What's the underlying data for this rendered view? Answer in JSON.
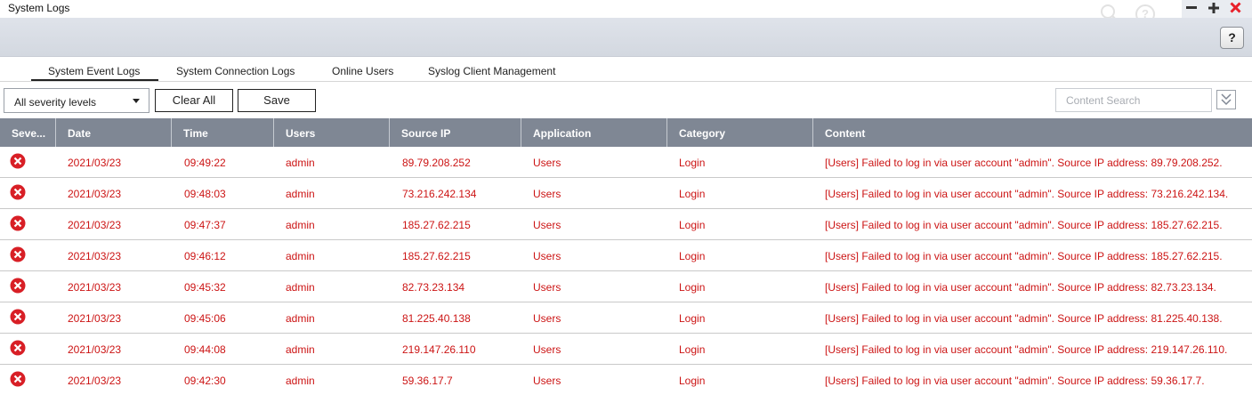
{
  "window": {
    "title": "System Logs",
    "icons": [
      "search-icon",
      "help-circle-icon",
      "minimize-icon",
      "maximize-icon",
      "close-icon"
    ],
    "close_color": "#e8202a"
  },
  "toolbar": {
    "help_label": "?"
  },
  "tabs": [
    {
      "label": "System Event Logs",
      "active": true
    },
    {
      "label": "System Connection Logs",
      "active": false
    },
    {
      "label": "Online Users",
      "active": false
    },
    {
      "label": "Syslog Client Management",
      "active": false
    }
  ],
  "filter": {
    "severity_value": "All severity levels",
    "clear_all_label": "Clear All",
    "save_label": "Save",
    "search_placeholder": "Content Search",
    "search_value": ""
  },
  "table": {
    "columns": [
      "Seve...",
      "Date",
      "Time",
      "Users",
      "Source IP",
      "Application",
      "Category",
      "Content"
    ],
    "header_color": "#7f8794",
    "error_color": "#cc1414",
    "rows": [
      {
        "severity": "error-icon",
        "date": "2021/03/23",
        "time": "09:49:22",
        "user": "admin",
        "ip": "89.79.208.252",
        "application": "Users",
        "category": "Login",
        "content": "[Users] Failed to log in via user account \"admin\". Source IP address: 89.79.208.252."
      },
      {
        "severity": "error-icon",
        "date": "2021/03/23",
        "time": "09:48:03",
        "user": "admin",
        "ip": "73.216.242.134",
        "application": "Users",
        "category": "Login",
        "content": "[Users] Failed to log in via user account \"admin\". Source IP address: 73.216.242.134."
      },
      {
        "severity": "error-icon",
        "date": "2021/03/23",
        "time": "09:47:37",
        "user": "admin",
        "ip": "185.27.62.215",
        "application": "Users",
        "category": "Login",
        "content": "[Users] Failed to log in via user account \"admin\". Source IP address: 185.27.62.215."
      },
      {
        "severity": "error-icon",
        "date": "2021/03/23",
        "time": "09:46:12",
        "user": "admin",
        "ip": "185.27.62.215",
        "application": "Users",
        "category": "Login",
        "content": "[Users] Failed to log in via user account \"admin\". Source IP address: 185.27.62.215."
      },
      {
        "severity": "error-icon",
        "date": "2021/03/23",
        "time": "09:45:32",
        "user": "admin",
        "ip": "82.73.23.134",
        "application": "Users",
        "category": "Login",
        "content": "[Users] Failed to log in via user account \"admin\". Source IP address: 82.73.23.134."
      },
      {
        "severity": "error-icon",
        "date": "2021/03/23",
        "time": "09:45:06",
        "user": "admin",
        "ip": "81.225.40.138",
        "application": "Users",
        "category": "Login",
        "content": "[Users] Failed to log in via user account \"admin\". Source IP address: 81.225.40.138."
      },
      {
        "severity": "error-icon",
        "date": "2021/03/23",
        "time": "09:44:08",
        "user": "admin",
        "ip": "219.147.26.110",
        "application": "Users",
        "category": "Login",
        "content": "[Users] Failed to log in via user account \"admin\". Source IP address: 219.147.26.110."
      },
      {
        "severity": "error-icon",
        "date": "2021/03/23",
        "time": "09:42:30",
        "user": "admin",
        "ip": "59.36.17.7",
        "application": "Users",
        "category": "Login",
        "content": "[Users] Failed to log in via user account \"admin\". Source IP address: 59.36.17.7."
      }
    ]
  }
}
